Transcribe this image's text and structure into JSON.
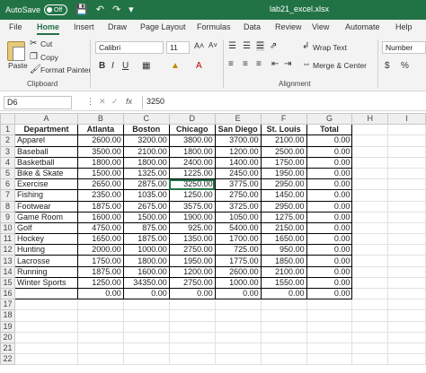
{
  "title_bar": {
    "autosave_label": "AutoSave",
    "autosave_state": "Off",
    "filename": "lab21_excel.xlsx"
  },
  "menu_tabs": [
    "File",
    "Home",
    "Insert",
    "Draw",
    "Page Layout",
    "Formulas",
    "Data",
    "Review",
    "View",
    "Automate",
    "Help"
  ],
  "active_tab": "Home",
  "ribbon": {
    "paste_label": "Paste",
    "cut_label": "Cut",
    "copy_label": "Copy",
    "format_painter_label": "Format Painter",
    "clipboard_group": "Clipboard",
    "font_name": "Calibri",
    "font_size": "11",
    "wrap_text_label": "Wrap Text",
    "merge_center_label": "Merge & Center",
    "alignment_group": "Alignment",
    "number_format": "Number",
    "accent_color": "#217346"
  },
  "formula_bar": {
    "name_box": "D6",
    "fx_label": "fx",
    "formula": "3250"
  },
  "sheet": {
    "columns": [
      "A",
      "B",
      "C",
      "D",
      "E",
      "F",
      "G",
      "H",
      "I"
    ],
    "row_numbers": [
      "1",
      "2",
      "3",
      "4",
      "5",
      "6",
      "7",
      "8",
      "9",
      "10",
      "11",
      "12",
      "13",
      "14",
      "15",
      "16",
      "17",
      "18",
      "19",
      "20",
      "21",
      "22"
    ],
    "headers": [
      "Department",
      "Atlanta",
      "Boston",
      "Chicago",
      "San Diego",
      "St. Louis",
      "Total"
    ],
    "rows": [
      [
        "Apparel",
        "2600.00",
        "3200.00",
        "3800.00",
        "3700.00",
        "2100.00",
        "0.00"
      ],
      [
        "Baseball",
        "3500.00",
        "2100.00",
        "1800.00",
        "1200.00",
        "2500.00",
        "0.00"
      ],
      [
        "Basketball",
        "1800.00",
        "1800.00",
        "2400.00",
        "1400.00",
        "1750.00",
        "0.00"
      ],
      [
        "Bike & Skate",
        "1500.00",
        "1325.00",
        "1225.00",
        "2450.00",
        "1950.00",
        "0.00"
      ],
      [
        "Exercise",
        "2650.00",
        "2875.00",
        "3250.00",
        "3775.00",
        "2950.00",
        "0.00"
      ],
      [
        "Fishing",
        "2350.00",
        "1035.00",
        "1250.00",
        "2750.00",
        "1450.00",
        "0.00"
      ],
      [
        "Footwear",
        "1875.00",
        "2675.00",
        "3575.00",
        "3725.00",
        "2950.00",
        "0.00"
      ],
      [
        "Game Room",
        "1600.00",
        "1500.00",
        "1900.00",
        "1050.00",
        "1275.00",
        "0.00"
      ],
      [
        "Golf",
        "4750.00",
        "875.00",
        "925.00",
        "5400.00",
        "2150.00",
        "0.00"
      ],
      [
        "Hockey",
        "1650.00",
        "1875.00",
        "1350.00",
        "1700.00",
        "1650.00",
        "0.00"
      ],
      [
        "Hunting",
        "2000.00",
        "1000.00",
        "2750.00",
        "725.00",
        "950.00",
        "0.00"
      ],
      [
        "Lacrosse",
        "1750.00",
        "1800.00",
        "1950.00",
        "1775.00",
        "1850.00",
        "0.00"
      ],
      [
        "Running",
        "1875.00",
        "1600.00",
        "1200.00",
        "2600.00",
        "2100.00",
        "0.00"
      ],
      [
        "Winter Sports",
        "1250.00",
        "34350.00",
        "2750.00",
        "1000.00",
        "1550.00",
        "0.00"
      ]
    ],
    "totals": [
      "",
      "0.00",
      "0.00",
      "0.00",
      "0.00",
      "0.00",
      "0.00"
    ]
  }
}
